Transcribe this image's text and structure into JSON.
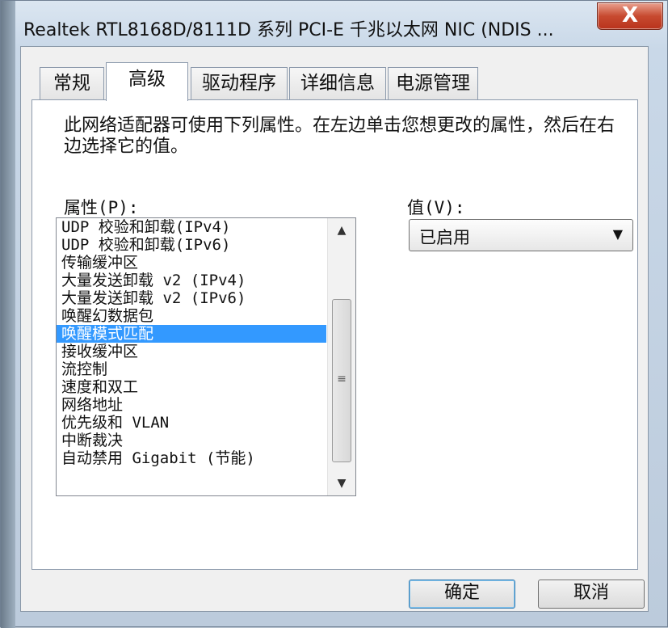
{
  "window": {
    "title": "Realtek RTL8168D/8111D 系列 PCI-E 千兆以太网 NIC (NDIS ...",
    "close_label": "X"
  },
  "tabs": [
    {
      "label": "常规"
    },
    {
      "label": "高级"
    },
    {
      "label": "驱动程序"
    },
    {
      "label": "详细信息"
    },
    {
      "label": "电源管理"
    }
  ],
  "active_tab": "高级",
  "description": "此网络适配器可使用下列属性。在左边单击您想更改的属性，然后在右边选择它的值。",
  "property_label": "属性(P):",
  "value_label": "值(V):",
  "properties": [
    "UDP 校验和卸载(IPv4)",
    "UDP 校验和卸载(IPv6)",
    "传输缓冲区",
    "大量发送卸载 v2 (IPv4)",
    "大量发送卸载 v2 (IPv6)",
    "唤醒幻数据包",
    "唤醒模式匹配",
    "接收缓冲区",
    "流控制",
    "速度和双工",
    "网络地址",
    "优先级和 VLAN",
    "中断裁决",
    "自动禁用 Gigabit (节能)"
  ],
  "selected_property": "唤醒模式匹配",
  "value_select": {
    "selected": "已启用"
  },
  "scrollbar": {
    "up_icon": "▲",
    "down_icon": "▼",
    "grip": "≡"
  },
  "buttons": {
    "ok": "确定",
    "cancel": "取消"
  },
  "colors": {
    "selection": "#3399ff",
    "close_button": "#c74a30"
  }
}
